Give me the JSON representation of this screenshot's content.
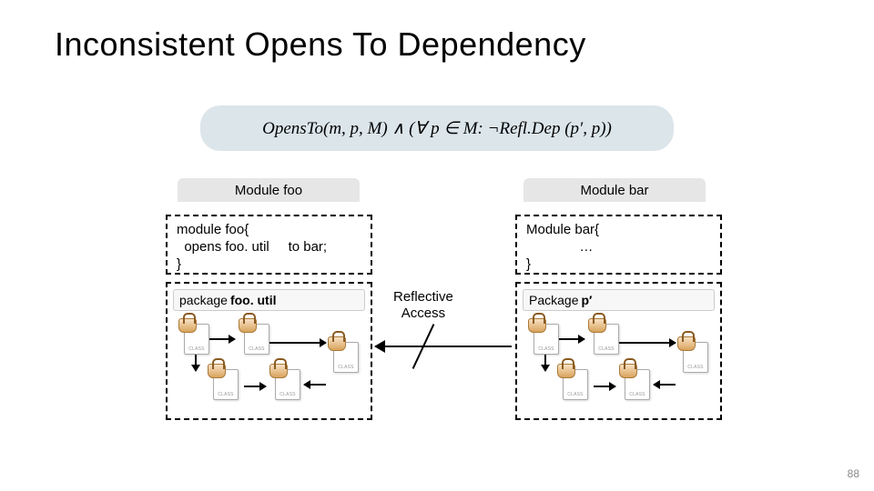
{
  "title": "Inconsistent Opens To Dependency",
  "formula": "OpensTo(m, p, M)  ∧ (∀ p ∈ M: ¬Refl.Dep (p′, p))",
  "modules": {
    "foo_header": "Module foo",
    "bar_header": "Module bar",
    "foo_code": "module foo{\n  opens foo. util     to bar;\n}",
    "bar_code": "Module bar{\n              …\n}"
  },
  "packages": {
    "foo_kw": "package ",
    "foo_name": "foo. util",
    "bar_kw": "Package ",
    "bar_name": "p′"
  },
  "reflective_label": "Reflective\nAccess",
  "page_number": "88"
}
